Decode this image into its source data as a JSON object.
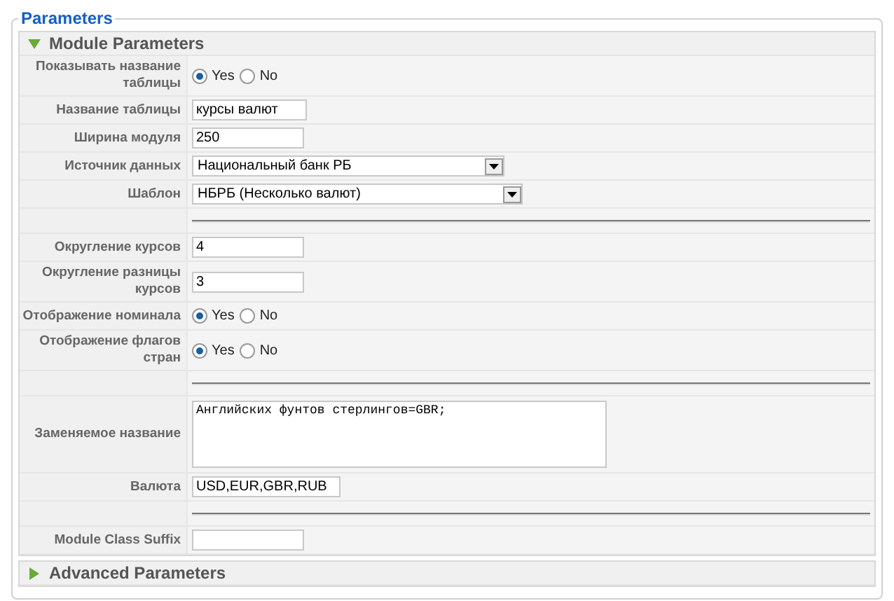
{
  "fieldset": {
    "legend": "Parameters"
  },
  "panels": [
    {
      "title": "Module Parameters",
      "expanded": true,
      "rows": [
        {
          "kind": "radio",
          "label": "Показывать название таблицы",
          "options": [
            {
              "label": "Yes",
              "selected": true
            },
            {
              "label": "No",
              "selected": false
            }
          ]
        },
        {
          "kind": "text",
          "label": "Название таблицы",
          "value": "курсы валют"
        },
        {
          "kind": "text",
          "label": "Ширина модуля",
          "value": "250"
        },
        {
          "kind": "select",
          "label": "Источник данных",
          "value": "Национальный банк РБ",
          "wide": false
        },
        {
          "kind": "select",
          "label": "Шаблон",
          "value": "НБРБ (Несколько валют)",
          "wide": true
        },
        {
          "kind": "separator"
        },
        {
          "kind": "text",
          "label": "Округление курсов",
          "value": "4"
        },
        {
          "kind": "text",
          "label": "Округление разницы курсов",
          "value": "3"
        },
        {
          "kind": "radio",
          "label": "Отображение номинала",
          "options": [
            {
              "label": "Yes",
              "selected": true
            },
            {
              "label": "No",
              "selected": false
            }
          ]
        },
        {
          "kind": "radio",
          "label": "Отображение флагов стран",
          "options": [
            {
              "label": "Yes",
              "selected": true
            },
            {
              "label": "No",
              "selected": false
            }
          ]
        },
        {
          "kind": "separator"
        },
        {
          "kind": "textarea",
          "label": "Заменяемое название",
          "value": "Английских фунтов стерлингов=GBR;"
        },
        {
          "kind": "text",
          "label": "Валюта",
          "value": "USD,EUR,GBR,RUB"
        },
        {
          "kind": "separator"
        },
        {
          "kind": "text",
          "label": "Module Class Suffix"
        }
      ]
    },
    {
      "title": "Advanced Parameters",
      "expanded": false
    }
  ]
}
